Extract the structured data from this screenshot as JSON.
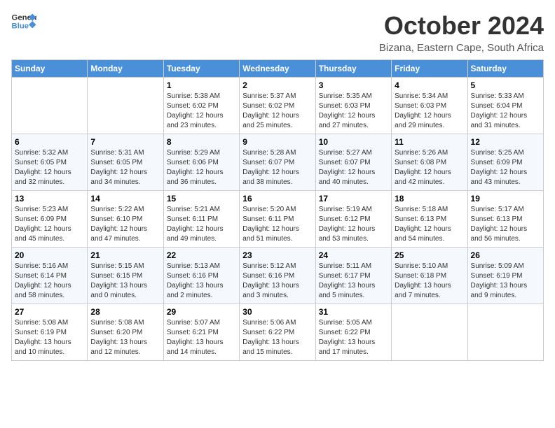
{
  "header": {
    "logo_general": "General",
    "logo_blue": "Blue",
    "title": "October 2024",
    "location": "Bizana, Eastern Cape, South Africa"
  },
  "weekdays": [
    "Sunday",
    "Monday",
    "Tuesday",
    "Wednesday",
    "Thursday",
    "Friday",
    "Saturday"
  ],
  "weeks": [
    [
      {
        "day": null
      },
      {
        "day": null
      },
      {
        "day": 1,
        "sunrise": "5:38 AM",
        "sunset": "6:02 PM",
        "daylight": "12 hours and 23 minutes."
      },
      {
        "day": 2,
        "sunrise": "5:37 AM",
        "sunset": "6:02 PM",
        "daylight": "12 hours and 25 minutes."
      },
      {
        "day": 3,
        "sunrise": "5:35 AM",
        "sunset": "6:03 PM",
        "daylight": "12 hours and 27 minutes."
      },
      {
        "day": 4,
        "sunrise": "5:34 AM",
        "sunset": "6:03 PM",
        "daylight": "12 hours and 29 minutes."
      },
      {
        "day": 5,
        "sunrise": "5:33 AM",
        "sunset": "6:04 PM",
        "daylight": "12 hours and 31 minutes."
      }
    ],
    [
      {
        "day": 6,
        "sunrise": "5:32 AM",
        "sunset": "6:05 PM",
        "daylight": "12 hours and 32 minutes."
      },
      {
        "day": 7,
        "sunrise": "5:31 AM",
        "sunset": "6:05 PM",
        "daylight": "12 hours and 34 minutes."
      },
      {
        "day": 8,
        "sunrise": "5:29 AM",
        "sunset": "6:06 PM",
        "daylight": "12 hours and 36 minutes."
      },
      {
        "day": 9,
        "sunrise": "5:28 AM",
        "sunset": "6:07 PM",
        "daylight": "12 hours and 38 minutes."
      },
      {
        "day": 10,
        "sunrise": "5:27 AM",
        "sunset": "6:07 PM",
        "daylight": "12 hours and 40 minutes."
      },
      {
        "day": 11,
        "sunrise": "5:26 AM",
        "sunset": "6:08 PM",
        "daylight": "12 hours and 42 minutes."
      },
      {
        "day": 12,
        "sunrise": "5:25 AM",
        "sunset": "6:09 PM",
        "daylight": "12 hours and 43 minutes."
      }
    ],
    [
      {
        "day": 13,
        "sunrise": "5:23 AM",
        "sunset": "6:09 PM",
        "daylight": "12 hours and 45 minutes."
      },
      {
        "day": 14,
        "sunrise": "5:22 AM",
        "sunset": "6:10 PM",
        "daylight": "12 hours and 47 minutes."
      },
      {
        "day": 15,
        "sunrise": "5:21 AM",
        "sunset": "6:11 PM",
        "daylight": "12 hours and 49 minutes."
      },
      {
        "day": 16,
        "sunrise": "5:20 AM",
        "sunset": "6:11 PM",
        "daylight": "12 hours and 51 minutes."
      },
      {
        "day": 17,
        "sunrise": "5:19 AM",
        "sunset": "6:12 PM",
        "daylight": "12 hours and 53 minutes."
      },
      {
        "day": 18,
        "sunrise": "5:18 AM",
        "sunset": "6:13 PM",
        "daylight": "12 hours and 54 minutes."
      },
      {
        "day": 19,
        "sunrise": "5:17 AM",
        "sunset": "6:13 PM",
        "daylight": "12 hours and 56 minutes."
      }
    ],
    [
      {
        "day": 20,
        "sunrise": "5:16 AM",
        "sunset": "6:14 PM",
        "daylight": "12 hours and 58 minutes."
      },
      {
        "day": 21,
        "sunrise": "5:15 AM",
        "sunset": "6:15 PM",
        "daylight": "13 hours and 0 minutes."
      },
      {
        "day": 22,
        "sunrise": "5:13 AM",
        "sunset": "6:16 PM",
        "daylight": "13 hours and 2 minutes."
      },
      {
        "day": 23,
        "sunrise": "5:12 AM",
        "sunset": "6:16 PM",
        "daylight": "13 hours and 3 minutes."
      },
      {
        "day": 24,
        "sunrise": "5:11 AM",
        "sunset": "6:17 PM",
        "daylight": "13 hours and 5 minutes."
      },
      {
        "day": 25,
        "sunrise": "5:10 AM",
        "sunset": "6:18 PM",
        "daylight": "13 hours and 7 minutes."
      },
      {
        "day": 26,
        "sunrise": "5:09 AM",
        "sunset": "6:19 PM",
        "daylight": "13 hours and 9 minutes."
      }
    ],
    [
      {
        "day": 27,
        "sunrise": "5:08 AM",
        "sunset": "6:19 PM",
        "daylight": "13 hours and 10 minutes."
      },
      {
        "day": 28,
        "sunrise": "5:08 AM",
        "sunset": "6:20 PM",
        "daylight": "13 hours and 12 minutes."
      },
      {
        "day": 29,
        "sunrise": "5:07 AM",
        "sunset": "6:21 PM",
        "daylight": "13 hours and 14 minutes."
      },
      {
        "day": 30,
        "sunrise": "5:06 AM",
        "sunset": "6:22 PM",
        "daylight": "13 hours and 15 minutes."
      },
      {
        "day": 31,
        "sunrise": "5:05 AM",
        "sunset": "6:22 PM",
        "daylight": "13 hours and 17 minutes."
      },
      {
        "day": null
      },
      {
        "day": null
      }
    ]
  ],
  "labels": {
    "sunrise_prefix": "Sunrise: ",
    "sunset_prefix": "Sunset: ",
    "daylight_prefix": "Daylight: "
  }
}
